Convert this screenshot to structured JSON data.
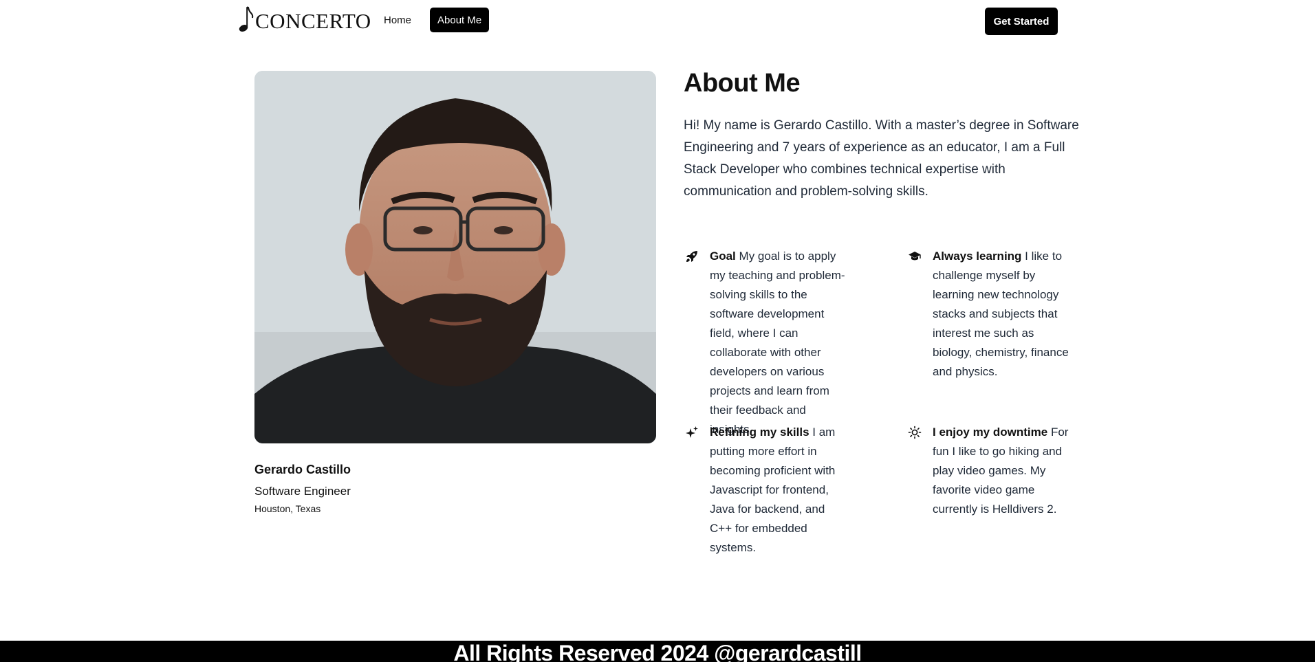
{
  "header": {
    "logo_text": "CONCERTO",
    "logo_icon": "music-note-icon",
    "nav": [
      {
        "label": "Home",
        "active": false
      },
      {
        "label": "About Me",
        "active": true
      }
    ],
    "cta_label": "Get Started"
  },
  "profile": {
    "photo": "portrait-photo",
    "name": "Gerardo Castillo",
    "role": "Software Engineer",
    "location": "Houston, Texas"
  },
  "about": {
    "title": "About Me",
    "bio": "Hi! My name is Gerardo Castillo. With a master’s degree in Software Engineering and 7 years of experience as an educator, I am a Full Stack Developer who combines technical expertise with communication and problem-solving skills."
  },
  "features": [
    {
      "icon": "rocket-icon",
      "title": "Goal",
      "text": "My goal is to apply my teaching and problem-solving skills to the software development field, where I can collaborate with other developers on various projects and learn from their feedback and insights."
    },
    {
      "icon": "graduation-cap-icon",
      "title": "Always learning",
      "text": "I like to challenge myself by learning new technology stacks and subjects that interest me such as biology, chemistry, finance and physics."
    },
    {
      "icon": "sparkles-icon",
      "title": "Refining my skills",
      "text": "I am putting more effort in becoming proficient with Javascript for frontend, Java for backend, and C++ for embedded systems."
    },
    {
      "icon": "sun-icon",
      "title": "I enjoy my downtime",
      "text": "For fun I like to go hiking and play video games. My favorite video game currently is Helldivers 2."
    }
  ],
  "footer": {
    "text": "All Rights Reserved 2024 @gerardcastill"
  },
  "colors": {
    "primary": "#000000",
    "background": "#ffffff",
    "text": "#111111"
  }
}
